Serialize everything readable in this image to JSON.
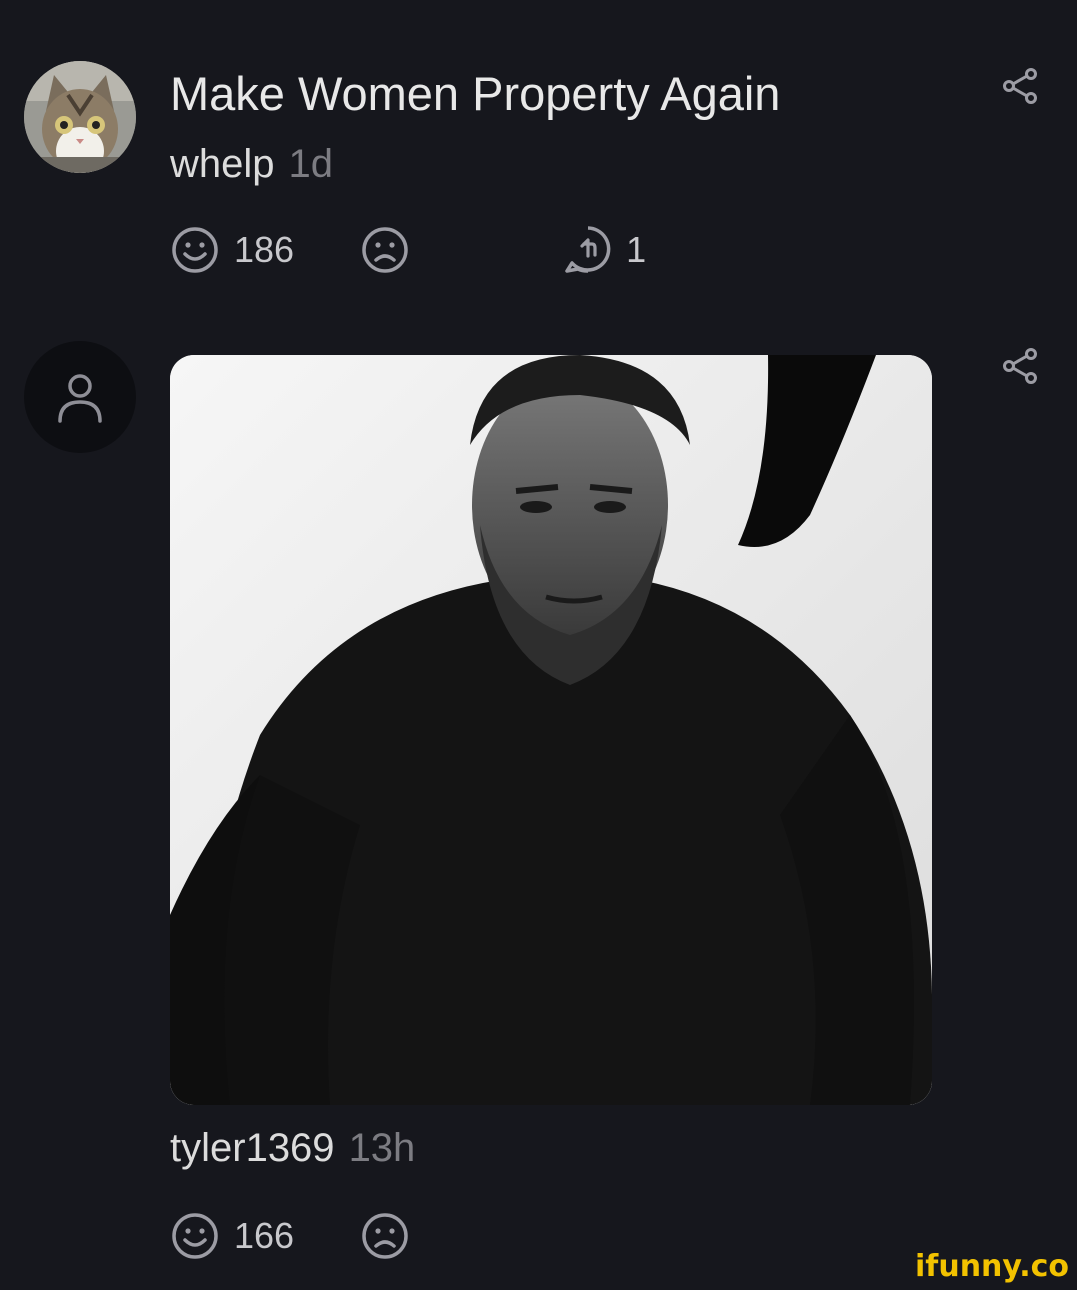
{
  "post": {
    "title": "Make Women Property Again",
    "user": "whelp",
    "time": "1d",
    "likes": "186",
    "replies": "1"
  },
  "comment": {
    "user": "tyler1369",
    "time": "13h",
    "likes": "166"
  },
  "watermark": "ifunny.co",
  "colors": {
    "background": "#16171d",
    "text": "#e6e6e6",
    "muted": "#7c7c82",
    "icon": "#9c9ca4",
    "watermark": "#f2c200"
  },
  "icons": {
    "smile": "smile-icon",
    "frown": "frown-icon",
    "reply": "reply-icon",
    "share": "share-icon",
    "user": "user-icon"
  }
}
